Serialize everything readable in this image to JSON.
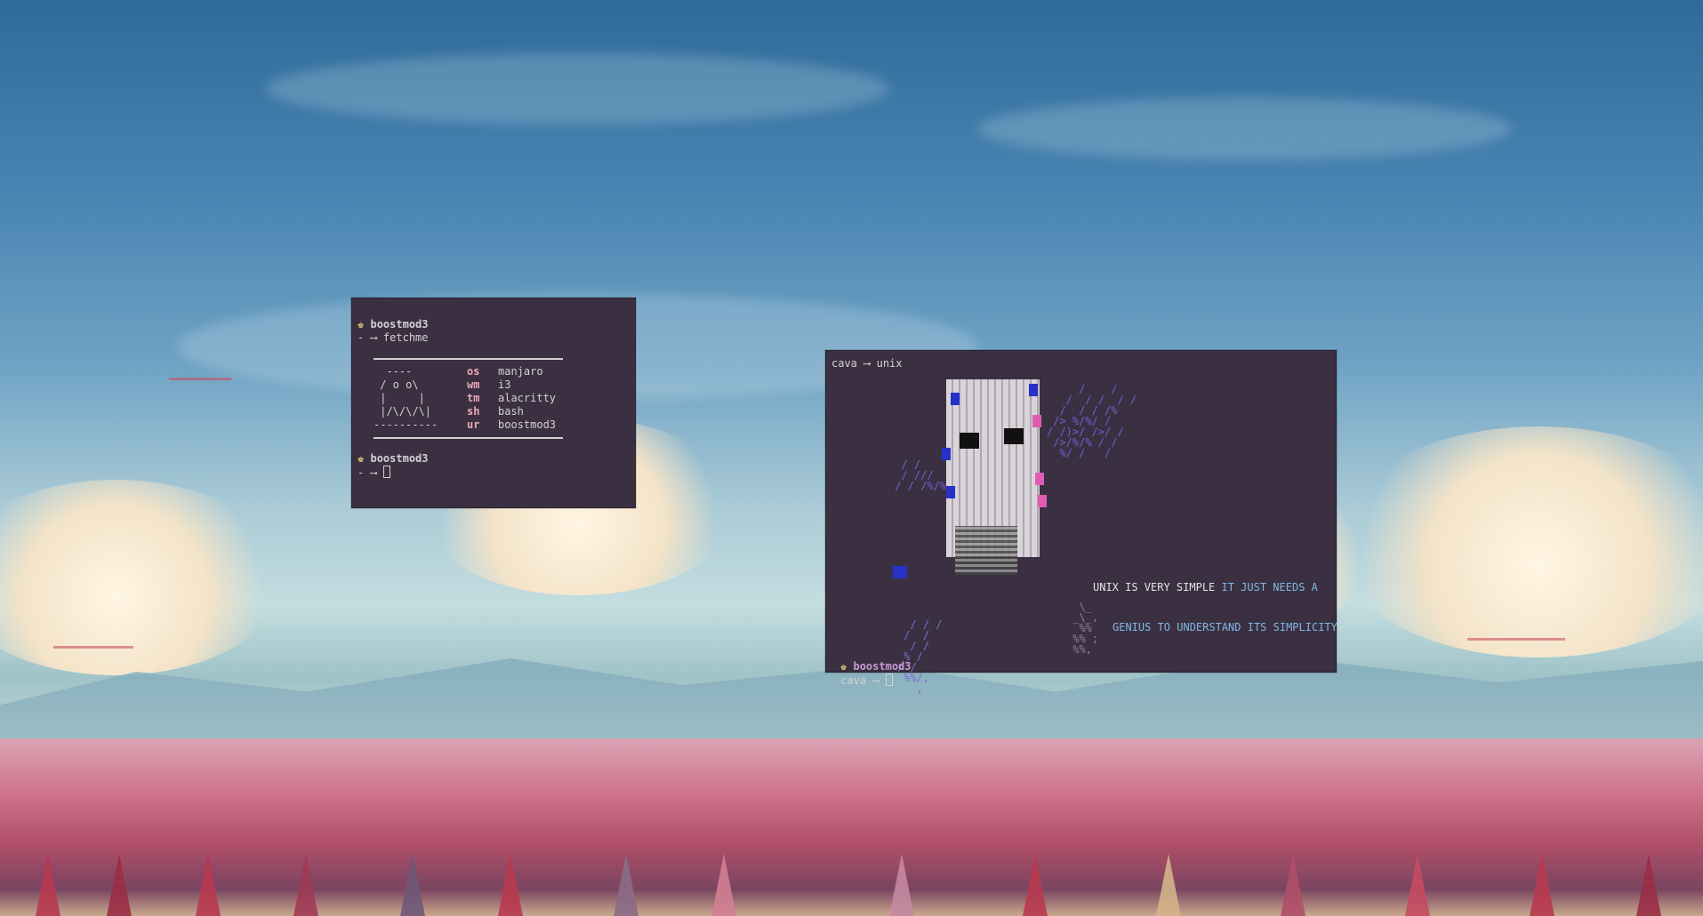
{
  "term_left": {
    "user": "boostmod3",
    "command": "fetchme",
    "art": [
      "  ----",
      " / o o\\",
      " |     |",
      " |/\\/\\/\\|",
      "----------"
    ],
    "keys": [
      "os",
      "wm",
      "tm",
      "sh",
      "ur"
    ],
    "values": [
      "manjaro",
      "i3",
      "alacritty",
      "bash",
      "boostmod3"
    ],
    "prompt2_user": "boostmod3",
    "arrow": "- ⟶"
  },
  "term_right": {
    "header_prefix": "cava",
    "header_arrow": "⟶",
    "header_cmd": "unix",
    "quote_line1_white": "UNIX IS VERY SIMPLE ",
    "quote_line1_blue": "IT JUST NEEDS A",
    "quote_line2_blue": "GENIUS TO UNDERSTAND ITS SIMPLICITY",
    "user": "boostmod3",
    "prompt_prefix": "cava",
    "prompt_arrow": "⟶"
  },
  "colors": {
    "terminal_bg": "#3b3041",
    "accent_pink": "#e8a9b8",
    "accent_blue": "#7fb7e6",
    "accent_purple": "#c79ad6"
  }
}
